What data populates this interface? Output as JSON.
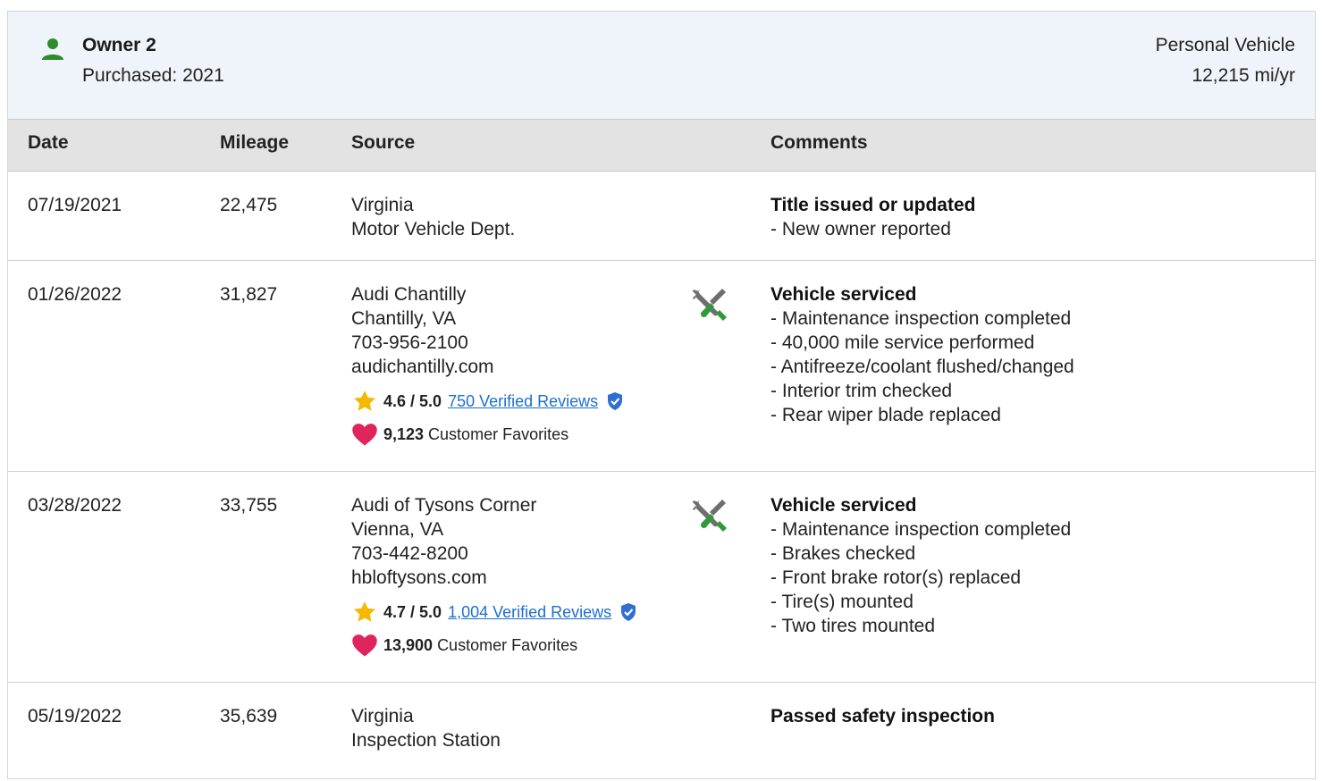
{
  "owner": {
    "name": "Owner 2",
    "purchased": "Purchased: 2021",
    "vehicle_type": "Personal Vehicle",
    "miles_per_year": "12,215 mi/yr"
  },
  "columns": {
    "date": "Date",
    "mileage": "Mileage",
    "source": "Source",
    "comments": "Comments"
  },
  "colors": {
    "owner_icon": "#2e8b2e",
    "service_icon_wrench": "#6e6e6e",
    "service_icon_handle": "#2e9a3a",
    "star": "#f5b800",
    "heart": "#e0245e",
    "link": "#1d6fd1",
    "verified_shield": "#2f6fd1"
  },
  "records": [
    {
      "date": "07/19/2021",
      "mileage": "22,475",
      "source": [
        "Virginia",
        "Motor Vehicle Dept."
      ],
      "icon": "",
      "comment_title": "Title issued or updated",
      "comments": [
        "- New owner reported"
      ]
    },
    {
      "date": "01/26/2022",
      "mileage": "31,827",
      "source": [
        "Audi Chantilly",
        "Chantilly, VA",
        "703-956-2100",
        "audichantilly.com"
      ],
      "icon": "service-tools-icon",
      "rating": {
        "score": "4.6 / 5.0",
        "reviews": "750 Verified Reviews"
      },
      "favorites": {
        "count": "9,123",
        "label": "Customer Favorites"
      },
      "comment_title": "Vehicle serviced",
      "comments": [
        "- Maintenance inspection completed",
        "- 40,000 mile service performed",
        "- Antifreeze/coolant flushed/changed",
        "- Interior trim checked",
        "- Rear wiper blade replaced"
      ]
    },
    {
      "date": "03/28/2022",
      "mileage": "33,755",
      "source": [
        "Audi of Tysons Corner",
        "Vienna, VA",
        "703-442-8200",
        "hbloftysons.com"
      ],
      "icon": "service-tools-icon",
      "rating": {
        "score": "4.7 / 5.0",
        "reviews": "1,004 Verified Reviews"
      },
      "favorites": {
        "count": "13,900",
        "label": "Customer Favorites"
      },
      "comment_title": "Vehicle serviced",
      "comments": [
        "- Maintenance inspection completed",
        "- Brakes checked",
        "- Front brake rotor(s) replaced",
        "- Tire(s) mounted",
        "- Two tires mounted"
      ]
    },
    {
      "date": "05/19/2022",
      "mileage": "35,639",
      "source": [
        "Virginia",
        "Inspection Station"
      ],
      "icon": "",
      "comment_title": "Passed safety inspection",
      "comments": []
    }
  ]
}
